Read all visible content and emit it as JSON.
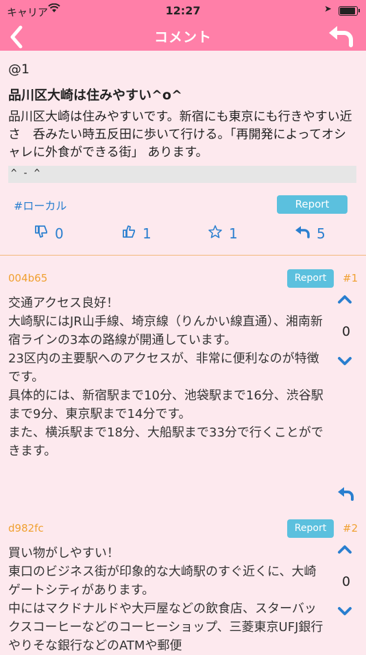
{
  "status": {
    "carrier": "キャリア",
    "time": "12:27"
  },
  "nav": {
    "title": "コメント"
  },
  "post": {
    "anchor": "@1",
    "title": "品川区大崎は住みやすい^o^",
    "body": "品川区大崎は住みやすいです。新宿にも東京にも行きやすい近さ　呑みたい時五反田に歩いて行ける。「再開発によってオシャレに外食ができる街」 あります。",
    "code": "^ - ^",
    "tag": "#ローカル",
    "report": "Report",
    "dislikes": "0",
    "likes": "1",
    "stars": "1",
    "replies": "5"
  },
  "comments": [
    {
      "author": "004b65",
      "num": "#1",
      "report": "Report",
      "text": "交通アクセス良好！\n大崎駅にはJR山手線、埼京線（りんかい線直通）、湘南新宿ラインの3本の路線が開通しています。\n23区内の主要駅へのアクセスが、非常に便利なのが特徴です。\n具体的には、新宿駅まで10分、池袋駅まで16分、渋谷駅まで9分、東京駅まで14分です。\nまた、横浜駅まで18分、大船駅まで33分で行くことができます。",
      "votes": "0"
    },
    {
      "author": "d982fc",
      "num": "#2",
      "report": "Report",
      "text": "買い物がしやすい！\n東口のビジネス街が印象的な大崎駅のすぐ近くに、大崎ゲートシティがあります。\n中にはマクドナルドや大戸屋などの飲食店、スターバックスコーヒーなどのコーヒーショップ、三菱東京UFJ銀行やりそな銀行などのATMや郵便",
      "votes": "0"
    }
  ]
}
